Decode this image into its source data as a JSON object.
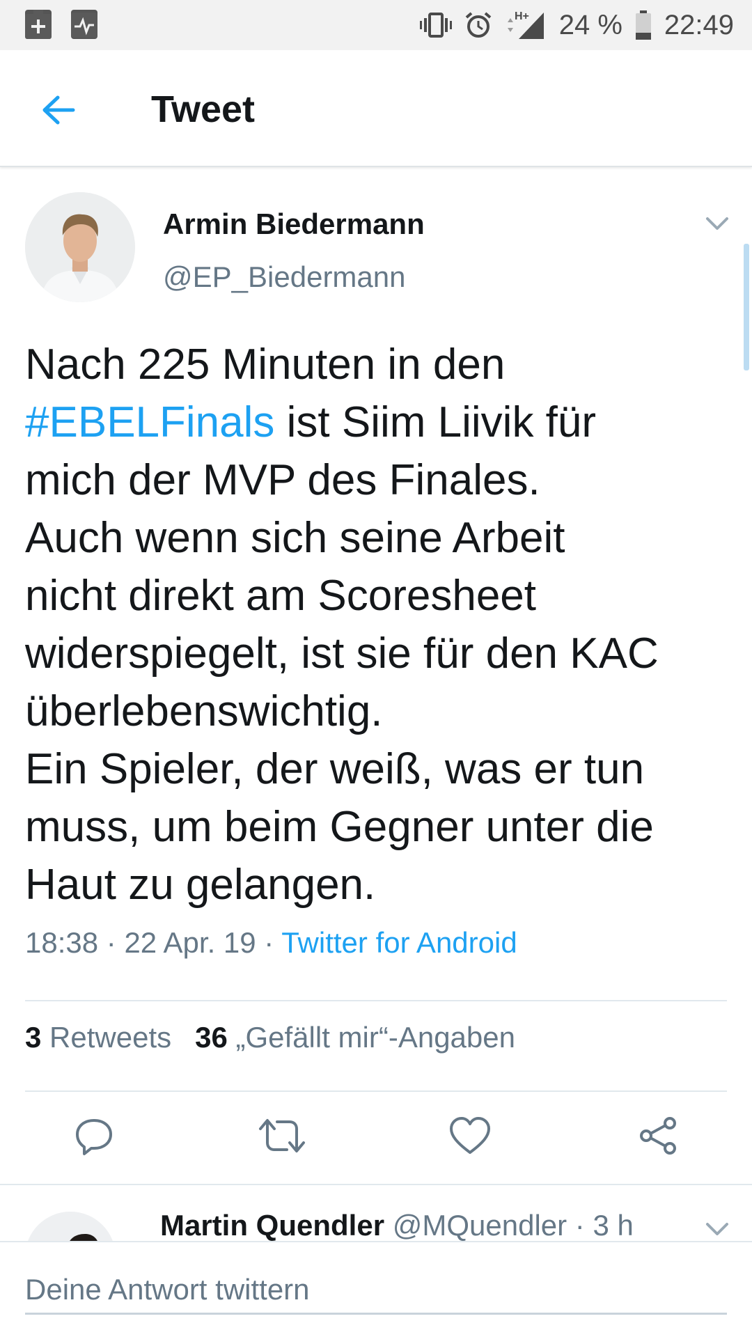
{
  "status_bar": {
    "left_icons": [
      "battery-plus-icon",
      "activity-monitor-icon"
    ],
    "right_icons": [
      "vibrate-icon",
      "alarm-icon",
      "signal-hplus-icon",
      "battery-icon"
    ],
    "battery": "24 %",
    "time": "22:49"
  },
  "app_bar": {
    "back_icon": "arrow-left-icon",
    "title": "Tweet"
  },
  "tweet": {
    "author_name": "Armin Biedermann",
    "author_handle": "@EP_Biedermann",
    "text_lines": [
      {
        "text": "Nach 225 Minuten in den"
      },
      {
        "hashtag": "#EBELFinals",
        "text": " ist Siim Liivik für"
      },
      {
        "text": "mich der MVP des Finales."
      },
      {
        "text": "Auch wenn sich seine Arbeit"
      },
      {
        "text": "nicht direkt am Scoresheet"
      },
      {
        "text": "widerspiegelt, ist sie für den KAC"
      },
      {
        "text": "überlebenswichtig."
      },
      {
        "text": "Ein Spieler, der weiß, was er tun"
      },
      {
        "text": "muss, um beim Gegner unter die"
      },
      {
        "text": "Haut zu gelangen."
      }
    ],
    "time": "18:38",
    "sep": "·",
    "date": "22 Apr. 19",
    "source": "Twitter for Android",
    "retweets_count": "3",
    "retweets_label": "Retweets",
    "likes_count": "36",
    "likes_label": "„Gefällt mir“-Angaben",
    "actions": [
      "reply-icon",
      "retweet-icon",
      "like-icon",
      "share-icon"
    ]
  },
  "reply_preview": {
    "name": "Martin Quendler",
    "handle": "@MQuendler",
    "sep": "·",
    "age": "3 h"
  },
  "compose": {
    "placeholder": "Deine Antwort twittern"
  },
  "colors": {
    "accent": "#1da1f2",
    "secondary_text": "#657786",
    "primary_text": "#14171a",
    "divider": "#e1e8ed"
  }
}
